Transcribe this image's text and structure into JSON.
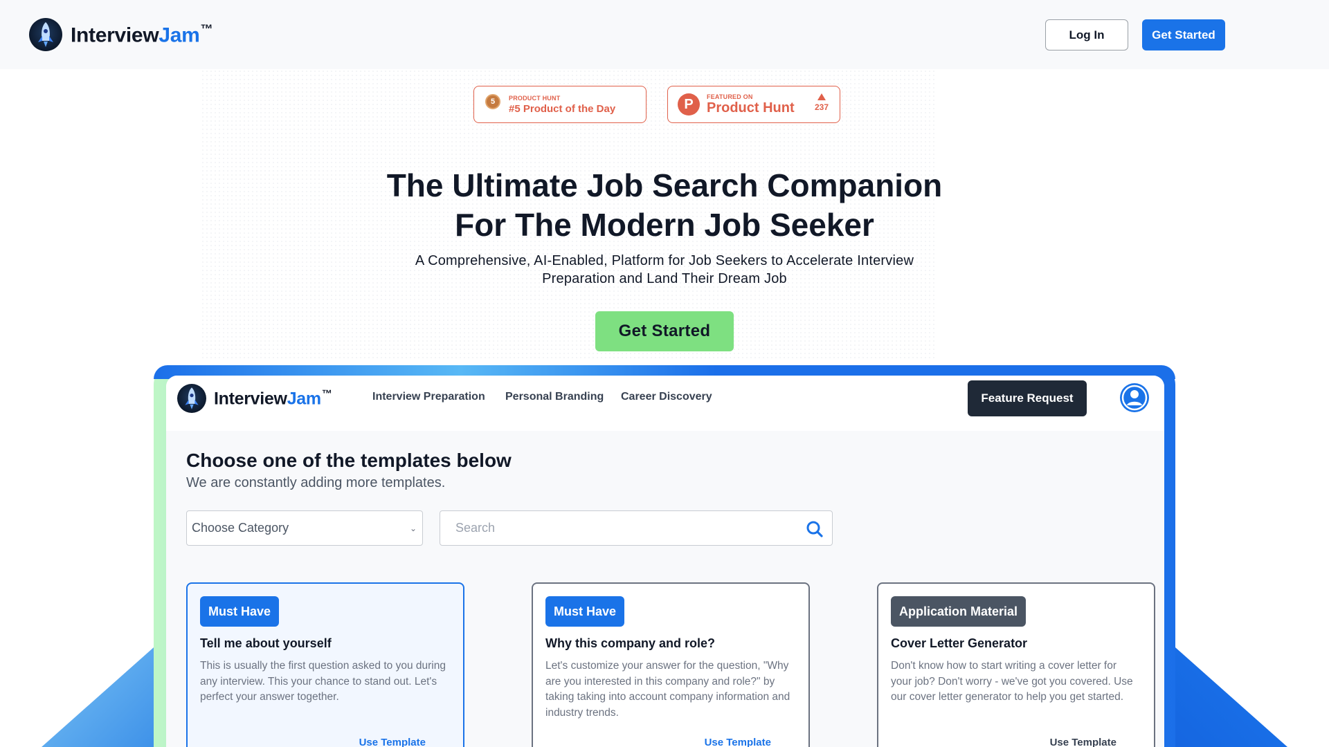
{
  "header": {
    "brand_main": "Interview",
    "brand_accent": "Jam",
    "brand_tm": "™",
    "login_label": "Log In",
    "get_started_label": "Get Started"
  },
  "badges": {
    "pod_small": "PRODUCT HUNT",
    "pod_text": "#5 Product of the Day",
    "pod_rank": "5",
    "featured_small": "FEATURED ON",
    "featured_text": "Product Hunt",
    "featured_votes": "237"
  },
  "hero": {
    "title_line1": "The Ultimate Job Search Companion",
    "title_line2": "For The Modern Job Seeker",
    "subtitle": "A Comprehensive, AI-Enabled, Platform for Job Seekers to Accelerate Interview Preparation and Land Their Dream Job",
    "cta_label": "Get Started"
  },
  "app": {
    "brand_main": "Interview",
    "brand_accent": "Jam",
    "brand_tm": "™",
    "nav": {
      "interview_prep": "Interview Preparation",
      "personal_branding": "Personal Branding",
      "career_discovery": "Career Discovery"
    },
    "feature_request_label": "Feature Request",
    "page_title": "Choose one of the templates below",
    "page_subtitle": "We are constantly adding more templates.",
    "category_placeholder": "Choose Category",
    "search_placeholder": "Search",
    "cards": [
      {
        "badge": "Must Have",
        "title": "Tell me about yourself",
        "description": "This is usually the first question asked to you during any interview. This your chance to stand out. Let's perfect your answer together.",
        "action": "Use Template"
      },
      {
        "badge": "Must Have",
        "title": "Why this company and role?",
        "description": "Let's customize your answer for the question, \"Why are you interested in this company and role?\" by taking taking into account company information and industry trends.",
        "action": "Use Template"
      },
      {
        "badge": "Application Material",
        "title": "Cover Letter Generator",
        "description": "Don't know how to start writing a cover letter for your job? Don't worry - we've got you covered. Use our cover letter generator to help you get started.",
        "action": "Use Template"
      }
    ]
  },
  "colors": {
    "primary_blue": "#1a73e8",
    "cta_green": "#7ee081",
    "ph_orange": "#e0604a",
    "dark_button": "#1f2937"
  },
  "icons": {
    "logo": "rocket-logo-icon",
    "medal": "medal-icon",
    "ph_logo": "product-hunt-icon",
    "upvote": "upvote-triangle-icon",
    "chevron": "chevron-down-icon",
    "search": "search-icon",
    "user": "user-avatar-icon"
  }
}
